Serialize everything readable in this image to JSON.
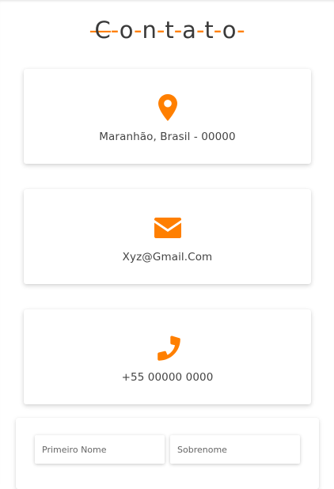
{
  "title": {
    "letters": [
      "C",
      "o",
      "n",
      "t",
      "a",
      "t",
      "o"
    ]
  },
  "accent_color": "#ff7f00",
  "cards": [
    {
      "icon": "map-pin-icon",
      "text": "Maranhão, Brasil - 00000"
    },
    {
      "icon": "envelope-icon",
      "text": "Xyz@Gmail.Com"
    },
    {
      "icon": "phone-icon",
      "text": "+55 00000 0000"
    }
  ],
  "form": {
    "first_name_placeholder": "Primeiro Nome",
    "last_name_placeholder": "Sobrenome"
  }
}
